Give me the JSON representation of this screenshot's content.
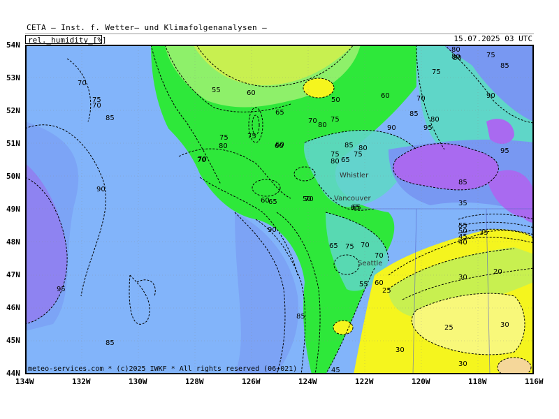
{
  "header": {
    "model_title": "CETA — Inst. f. Wetter— und Klimafolgenanalysen —",
    "parameter": "rel._humidity_[%]",
    "timestamp": "15.07.2025 03 UTC"
  },
  "axes": {
    "lat_labels": [
      "54N",
      "53N",
      "52N",
      "51N",
      "50N",
      "49N",
      "48N",
      "47N",
      "46N",
      "45N",
      "44N"
    ],
    "lon_labels": [
      "134W",
      "132W",
      "130W",
      "128W",
      "126W",
      "124W",
      "122W",
      "120W",
      "118W",
      "116W"
    ]
  },
  "cities": [
    "Whistler",
    "Vancouver",
    "Seattle"
  ],
  "contour_labels": [
    "70",
    "75",
    "85",
    "70",
    "75",
    "80",
    "55",
    "60",
    "50",
    "65",
    "60",
    "70",
    "75",
    "80",
    "85",
    "75",
    "80",
    "90",
    "70",
    "75",
    "80",
    "60",
    "70",
    "75",
    "80",
    "85",
    "95",
    "90",
    "95",
    "90",
    "70",
    "80",
    "85",
    "60",
    "75",
    "80",
    "65",
    "65",
    "60",
    "50",
    "70",
    "65",
    "65",
    "75",
    "70",
    "80",
    "55",
    "60",
    "35",
    "40",
    "45",
    "50",
    "55",
    "25",
    "30",
    "20",
    "25",
    "30",
    "35",
    "90",
    "85",
    "95",
    "85",
    "85",
    "65",
    "70",
    "75",
    "55",
    "30",
    "30",
    "45"
  ],
  "copyright": "meteo-services.com * (c)2025 IWKF * All rights reserved (06+021)",
  "legend_colors": {
    "very_humid": "#a96af0",
    "humid_blue": "#7898f2",
    "light_blue": "#82b4fa",
    "teal": "#5fd6c8",
    "green": "#2ee83a",
    "light_green": "#8ef06a",
    "yellow_green": "#c8f050",
    "yellow": "#f5f51e",
    "pale_yellow": "#f8f87a",
    "orange_pale": "#f5d79a"
  }
}
